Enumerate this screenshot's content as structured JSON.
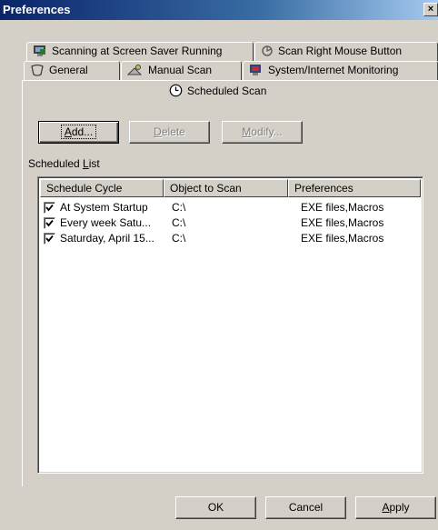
{
  "window": {
    "title": "Preferences",
    "close_glyph": "×"
  },
  "tabs_back": [
    {
      "label": "Scanning at Screen Saver Running",
      "icon": "screen-saver-icon"
    },
    {
      "label": "Scan Right Mouse Button",
      "icon": "mouse-button-icon"
    }
  ],
  "tabs_middle": [
    {
      "label": "General",
      "icon": "general-icon"
    },
    {
      "label": "Manual Scan",
      "icon": "manual-scan-icon"
    },
    {
      "label": "System/Internet Monitoring",
      "icon": "monitor-icon"
    }
  ],
  "tab_active": {
    "label": "Scheduled Scan",
    "icon": "clock-icon"
  },
  "buttons": {
    "add": {
      "pre": "",
      "ul": "A",
      "post": "dd..."
    },
    "delete": {
      "pre": "",
      "ul": "D",
      "post": "elete"
    },
    "modify": {
      "pre": "",
      "ul": "M",
      "post": "odify..."
    }
  },
  "list_label": {
    "pre": "Scheduled ",
    "ul": "L",
    "post": "ist"
  },
  "columns": [
    "Schedule Cycle",
    "Object to Scan",
    "Preferences"
  ],
  "rows": [
    {
      "checked": true,
      "cycle": "At System Startup",
      "object": "C:\\",
      "prefs": "EXE files,Macros"
    },
    {
      "checked": true,
      "cycle": "Every week Satu...",
      "object": "C:\\",
      "prefs": "EXE files,Macros"
    },
    {
      "checked": true,
      "cycle": "Saturday, April 15...",
      "object": "C:\\",
      "prefs": "EXE files,Macros"
    }
  ],
  "footer": {
    "ok": "OK",
    "cancel": "Cancel",
    "apply": {
      "ul": "A",
      "post": "pply"
    }
  }
}
